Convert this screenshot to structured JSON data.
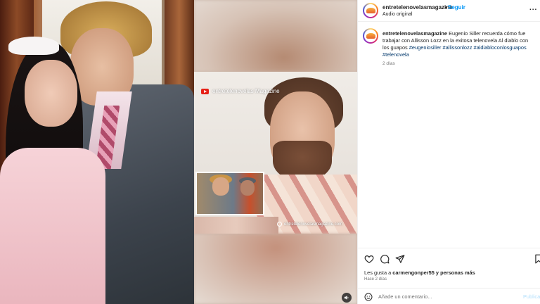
{
  "post": {
    "username": "entretelenovelasmagazine",
    "follow_label": "Seguir",
    "separator": "•",
    "audio": "Audio original",
    "more": "..."
  },
  "caption": {
    "username": "entretelenovelasmagazine",
    "text": "Eugenio Siller recuerda cómo fue trabajar con Allisson Lozz en la exitosa telenovela Al diablo con los guapos",
    "tags": [
      "#eugeniosiller",
      "#allissonlozz",
      "#aldiabloconlosguapos",
      "#telenovela"
    ],
    "time": "2 días"
  },
  "media": {
    "overlay_channel": "entretelenovelas Magazine",
    "watermark": "entretelenovelasmagazine.com"
  },
  "engagement": {
    "likes_prefix": "Les gusta a",
    "likes_user": "carmengonper55",
    "likes_suffix": "y personas más",
    "time": "Hace 2 días"
  },
  "comment": {
    "placeholder": "Añade un comentario...",
    "publish_label": "Publicar"
  },
  "icons": {
    "like": "heart-icon",
    "comment": "comment-icon",
    "share": "send-icon",
    "save": "bookmark-icon",
    "emoji": "emoji-icon",
    "mute": "speaker-icon"
  },
  "colors": {
    "accent": "#0095f6",
    "hashtag": "#00376b",
    "muted_text": "#737373",
    "publish_disabled": "#b2dffc"
  }
}
